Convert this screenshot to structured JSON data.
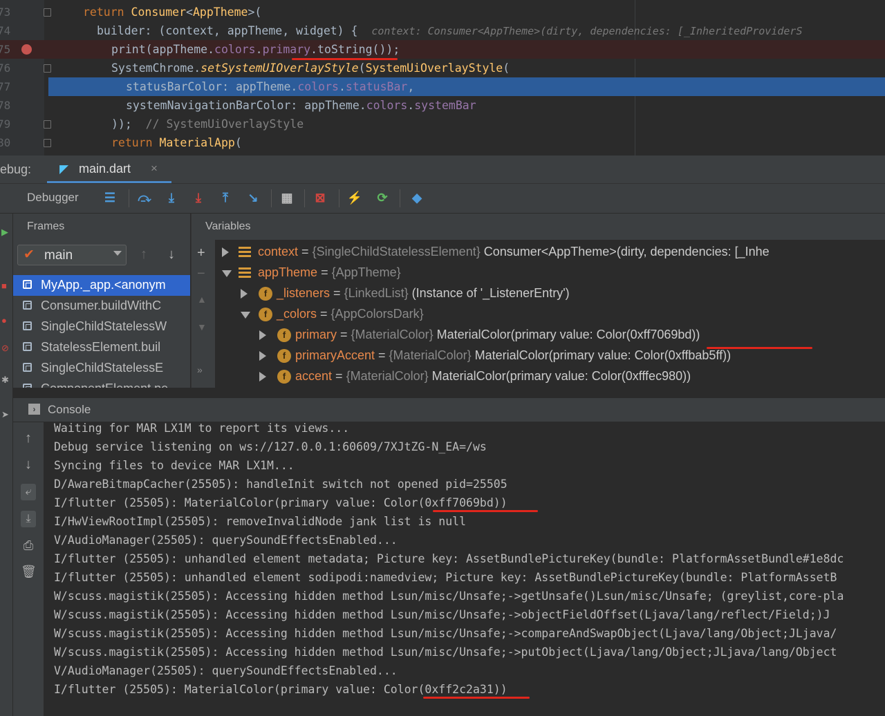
{
  "editor": {
    "lines": [
      {
        "num": "73",
        "parts": [
          {
            "t": "return ",
            "c": "kw"
          },
          {
            "t": "Consumer",
            "c": "cls"
          },
          {
            "t": "<"
          },
          {
            "t": "AppTheme",
            "c": "cls"
          },
          {
            "t": ">("
          }
        ],
        "indent": 120
      },
      {
        "num": "74",
        "parts": [
          {
            "t": "builder: (context, appTheme, widget) {  "
          },
          {
            "t": "context: Consumer<AppTheme>(dirty, dependencies: [_InheritedProviderS",
            "c": "hint"
          }
        ],
        "indent": 140
      },
      {
        "num": "75",
        "parts": [
          {
            "t": "print(appTheme."
          },
          {
            "t": "colors",
            "c": "fld"
          },
          {
            "t": "."
          },
          {
            "t": "primary",
            "c": "fld"
          },
          {
            "t": ".toString());"
          }
        ],
        "indent": 161
      },
      {
        "num": "76",
        "parts": [
          {
            "t": "SystemChrome."
          },
          {
            "t": "setSystemUIOverlayStyle",
            "c": "fn"
          },
          {
            "t": "("
          },
          {
            "t": "SystemUiOverlayStyle",
            "c": "cls"
          },
          {
            "t": "("
          }
        ],
        "indent": 161
      },
      {
        "num": "77",
        "parts": [
          {
            "t": "statusBarColor: appTheme."
          },
          {
            "t": "colors",
            "c": "fld"
          },
          {
            "t": "."
          },
          {
            "t": "statusBar",
            "c": "fld"
          },
          {
            "t": ","
          }
        ],
        "indent": 182
      },
      {
        "num": "78",
        "parts": [
          {
            "t": "systemNavigationBarColor: appTheme."
          },
          {
            "t": "colors",
            "c": "fld"
          },
          {
            "t": "."
          },
          {
            "t": "systemBar",
            "c": "fld"
          }
        ],
        "indent": 182
      },
      {
        "num": "79",
        "parts": [
          {
            "t": "));  "
          },
          {
            "t": "// SystemUiOverlayStyle",
            "c": "cmt"
          }
        ],
        "indent": 161
      },
      {
        "num": "80",
        "parts": [
          {
            "t": "return ",
            "c": "kw"
          },
          {
            "t": "MaterialApp",
            "c": "cls"
          },
          {
            "t": "("
          }
        ],
        "indent": 161
      }
    ]
  },
  "debug": {
    "label": "ebug:",
    "tab_label": "main.dart",
    "tab_close": "×"
  },
  "toolbar": {
    "debugger_label": "Debugger"
  },
  "frames": {
    "title": "Frames",
    "thread": "main",
    "items": [
      "MyApp._app.<anonym",
      "Consumer.buildWithC",
      "SingleChildStatelessW",
      "StatelessElement.buil",
      "SingleChildStatelessE",
      "ComponentElement.pe"
    ]
  },
  "variables": {
    "title": "Variables",
    "rows": [
      {
        "name": "context",
        "eq": " = ",
        "type": "{SingleChildStatelessElement}",
        "val": " Consumer<AppTheme>(dirty, dependencies: [_Inhe"
      },
      {
        "name": "appTheme",
        "eq": " = ",
        "type": "{AppTheme}",
        "val": ""
      },
      {
        "name": "_listeners",
        "eq": " = ",
        "type": "{LinkedList}",
        "val": " (Instance of '_ListenerEntry')"
      },
      {
        "name": "_colors",
        "eq": " = ",
        "type": "{AppColorsDark}",
        "val": ""
      },
      {
        "name": "primary",
        "eq": " = ",
        "type": "{MaterialColor}",
        "val": " MaterialColor(primary value: Color(0xff7069bd))"
      },
      {
        "name": "primaryAccent",
        "eq": " = ",
        "type": "{MaterialColor}",
        "val": " MaterialColor(primary value: Color(0xffbab5ff))"
      },
      {
        "name": "accent",
        "eq": " = ",
        "type": "{MaterialColor}",
        "val": " MaterialColor(primary value: Color(0xfffec980))"
      }
    ]
  },
  "console": {
    "title": "Console",
    "lines": [
      "Waiting for MAR LX1M to report its views...",
      "Debug service listening on ws://127.0.0.1:60609/7XJtZG-N_EA=/ws",
      "Syncing files to device MAR LX1M...",
      "D/AwareBitmapCacher(25505): handleInit switch not opened pid=25505",
      "I/flutter (25505): MaterialColor(primary value: Color(0xff7069bd))",
      "I/HwViewRootImpl(25505): removeInvalidNode jank list is null",
      "V/AudioManager(25505): querySoundEffectsEnabled...",
      "I/flutter (25505): unhandled element metadata; Picture key: AssetBundlePictureKey(bundle: PlatformAssetBundle#1e8dc",
      "I/flutter (25505): unhandled element sodipodi:namedview; Picture key: AssetBundlePictureKey(bundle: PlatformAssetB",
      "W/scuss.magistik(25505): Accessing hidden method Lsun/misc/Unsafe;->getUnsafe()Lsun/misc/Unsafe; (greylist,core-pla",
      "W/scuss.magistik(25505): Accessing hidden method Lsun/misc/Unsafe;->objectFieldOffset(Ljava/lang/reflect/Field;)J",
      "W/scuss.magistik(25505): Accessing hidden method Lsun/misc/Unsafe;->compareAndSwapObject(Ljava/lang/Object;JLjava/",
      "W/scuss.magistik(25505): Accessing hidden method Lsun/misc/Unsafe;->putObject(Ljava/lang/Object;JLjava/lang/Object",
      "V/AudioManager(25505): querySoundEffectsEnabled...",
      "I/flutter (25505): MaterialColor(primary value: Color(0xff2c2a31))"
    ]
  }
}
